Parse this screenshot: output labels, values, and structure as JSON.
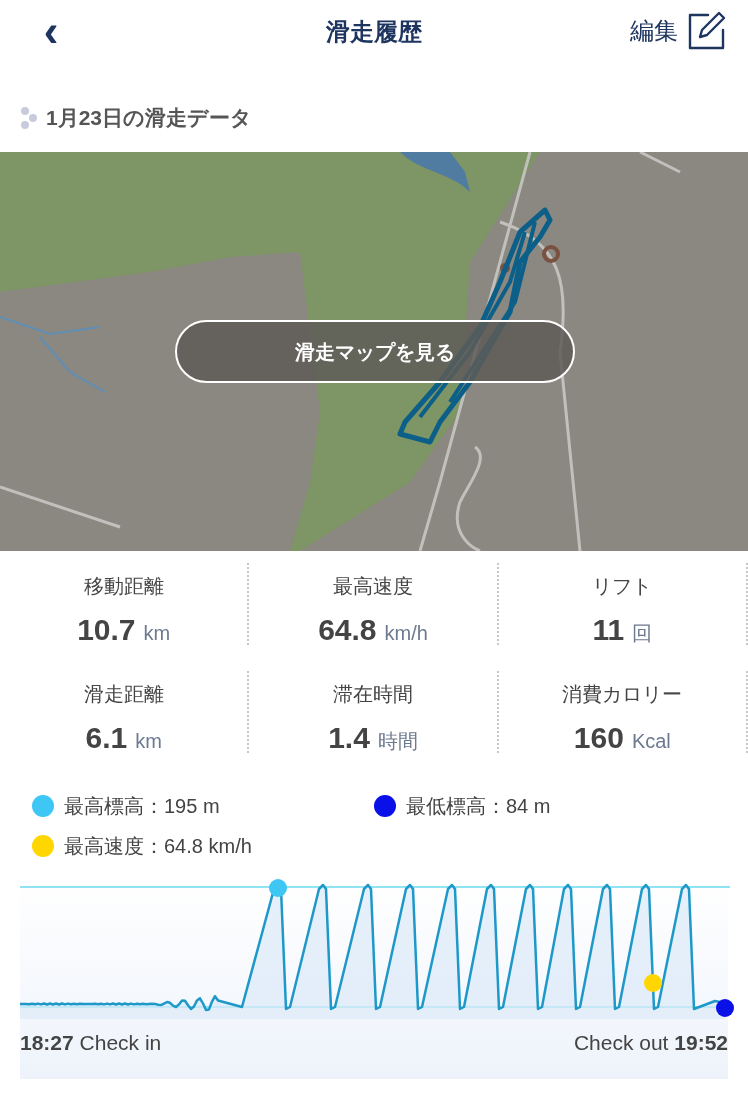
{
  "header": {
    "back": "‹",
    "title": "滑走履歴",
    "edit": "編集"
  },
  "section_title": "1月23日の滑走データ",
  "map": {
    "kind": "picture",
    "button": "滑走マップを見る"
  },
  "stats": [
    {
      "label": "移動距離",
      "value": "10.7",
      "unit": "km"
    },
    {
      "label": "最高速度",
      "value": "64.8",
      "unit": "km/h"
    },
    {
      "label": "リフト",
      "value": "11",
      "unit": "回"
    },
    {
      "label": "滑走距離",
      "value": "6.1",
      "unit": "km"
    },
    {
      "label": "滞在時間",
      "value": "1.4",
      "unit": "時間"
    },
    {
      "label": "消費カロリー",
      "value": "160",
      "unit": "Kcal"
    }
  ],
  "legend": [
    {
      "text": "最高標高：195 m",
      "color": "#3ec6f5"
    },
    {
      "text": "最低標高：84 m",
      "color": "#0a10e8"
    },
    {
      "text": "最高速度：64.8 km/h",
      "color": "#ffd600"
    }
  ],
  "check_in": "**18:27** Check in",
  "check_out": "Check out **19:52**"
}
